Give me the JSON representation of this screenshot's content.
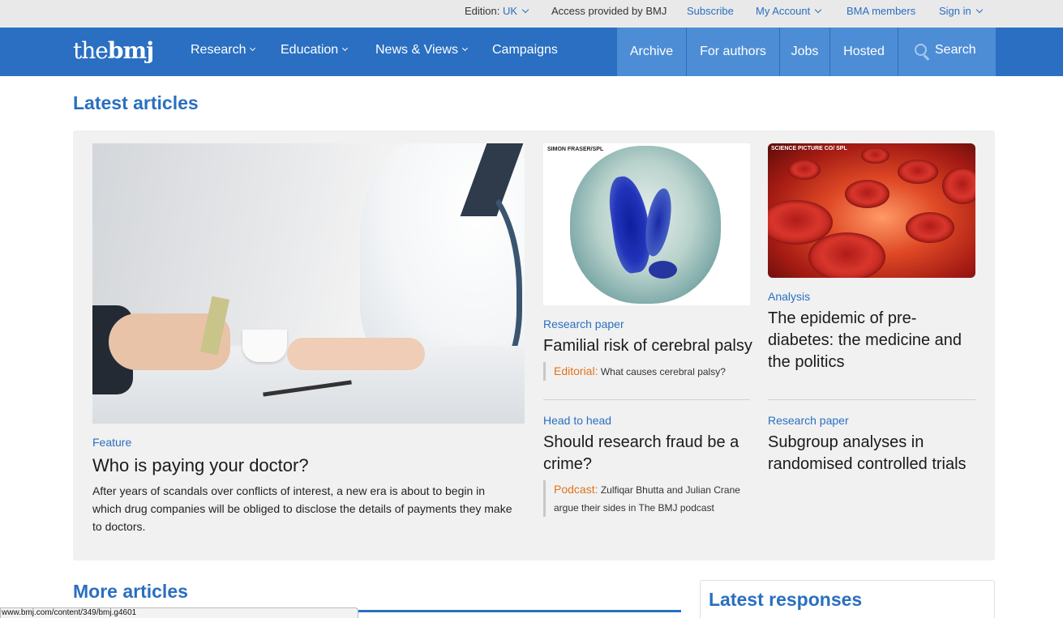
{
  "utility_bar": {
    "edition_label": "Edition:",
    "edition_value": "UK",
    "access_text": "Access provided by BMJ",
    "subscribe": "Subscribe",
    "my_account": "My Account",
    "bma_members": "BMA members",
    "sign_in": "Sign in"
  },
  "nav": {
    "logo_the": "the",
    "logo_bmj": "bmj",
    "items": [
      "Research",
      "Education",
      "News & Views",
      "Campaigns"
    ],
    "right_items": [
      "Archive",
      "For authors",
      "Jobs",
      "Hosted"
    ],
    "search": "Search"
  },
  "latest": {
    "heading": "Latest articles",
    "lead": {
      "kicker": "Feature",
      "title": "Who is paying your doctor?",
      "standfirst": "After years of scandals over conflicts of interest, a new era is about to begin in which drug companies will be obliged to disclose the details of payments they make to doctors."
    },
    "brain_credit": "SIMON FRASER/SPL",
    "blood_credit": "SCIENCE PICTURE CO/ SPL",
    "article2": {
      "kicker": "Research paper",
      "title": "Familial risk of cerebral palsy",
      "related_label": "Editorial:",
      "related_text": "What causes cerebral palsy?"
    },
    "article3": {
      "kicker": "Analysis",
      "title": "The epidemic of pre-diabetes: the medicine and the politics"
    },
    "article4": {
      "kicker": "Head to head",
      "title": "Should research fraud be a crime?",
      "related_label": "Podcast:",
      "related_text": "Zulfiqar Bhutta and Julian Crane argue their sides in The BMJ podcast"
    },
    "article5": {
      "kicker": "Research paper",
      "title": "Subgroup analyses in randomised controlled trials"
    }
  },
  "more_articles": {
    "heading": "More articles"
  },
  "latest_responses": {
    "heading": "Latest responses"
  },
  "status_bar": {
    "url": "www.bmj.com/content/349/bmj.g4601"
  },
  "colors": {
    "brand_blue": "#2a6fc1",
    "nav_light_blue": "#4d8dd6",
    "accent_orange": "#e0731b"
  }
}
